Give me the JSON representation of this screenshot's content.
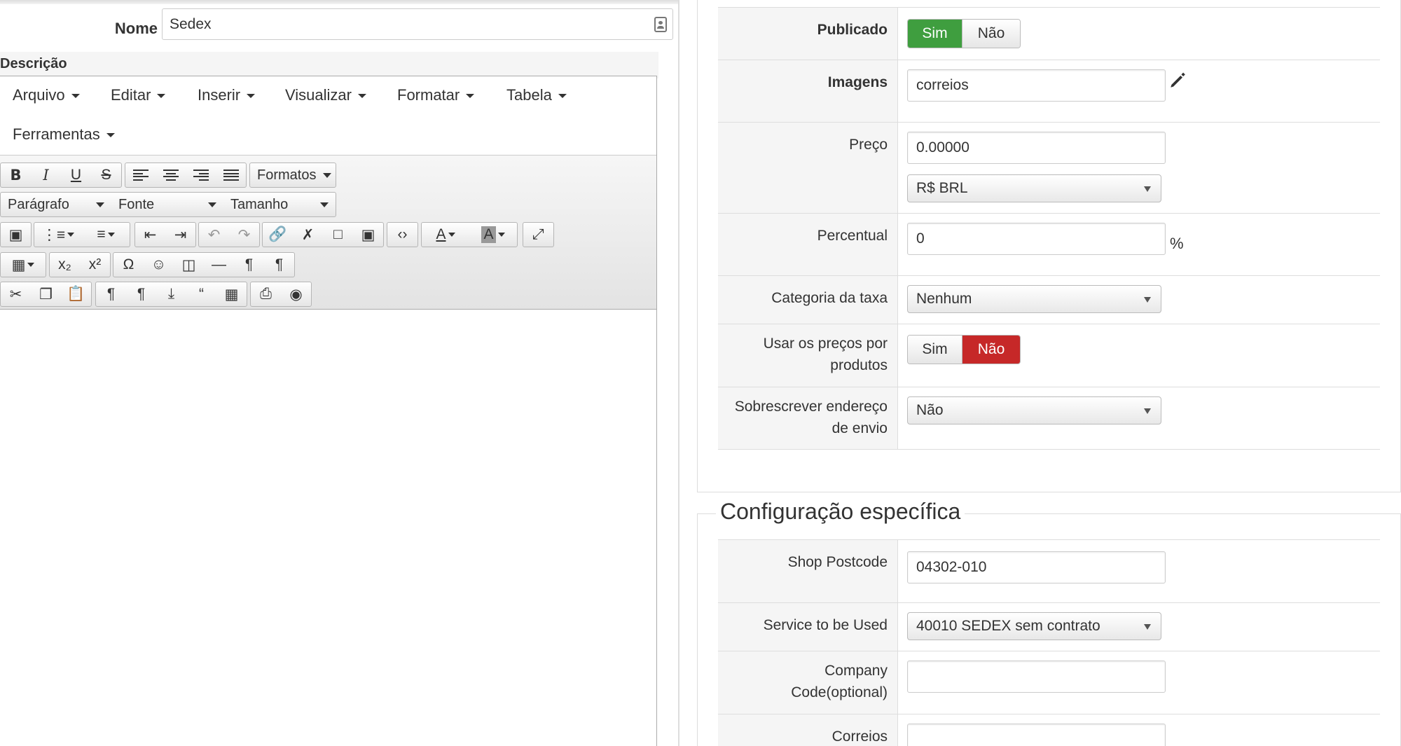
{
  "nome": {
    "label": "Nome",
    "value": "Sedex"
  },
  "descricao": {
    "label": "Descrição"
  },
  "editor": {
    "menus": [
      "Arquivo",
      "Editar",
      "Inserir",
      "Visualizar",
      "Formatar",
      "Tabela",
      "Ferramentas"
    ],
    "formatos_label": "Formatos",
    "paragrafo_label": "Parágrafo",
    "fonte_label": "Fonte",
    "tamanho_label": "Tamanho"
  },
  "form": {
    "publicado": {
      "label": "Publicado",
      "options": [
        "Sim",
        "Não"
      ],
      "selected": "Sim"
    },
    "imagens": {
      "label": "Imagens",
      "value": "correios"
    },
    "preco": {
      "label": "Preço",
      "value": "0.00000",
      "currency": "R$ BRL"
    },
    "percentual": {
      "label": "Percentual",
      "value": "0",
      "unit": "%"
    },
    "categoria_taxa": {
      "label": "Categoria da taxa",
      "value": "Nenhum"
    },
    "usar_precos": {
      "label_line1": "Usar os preços por",
      "label_line2": "produtos",
      "options": [
        "Sim",
        "Não"
      ],
      "selected": "Não"
    },
    "sobrescrever": {
      "label_line1": "Sobrescrever endereço",
      "label_line2": "de envio",
      "value": "Não"
    }
  },
  "config": {
    "title": "Configuração específica",
    "shop_postcode": {
      "label": "Shop Postcode",
      "value": "04302-010"
    },
    "service": {
      "label": "Service to be Used",
      "value": "40010 SEDEX sem contrato"
    },
    "company_code": {
      "label_line1": "Company",
      "label_line2": "Code(optional)",
      "value": ""
    },
    "correios": {
      "label": "Correios",
      "value": ""
    }
  },
  "colors": {
    "toggle_yes": "#3f9e3f",
    "toggle_no": "#c62828"
  }
}
